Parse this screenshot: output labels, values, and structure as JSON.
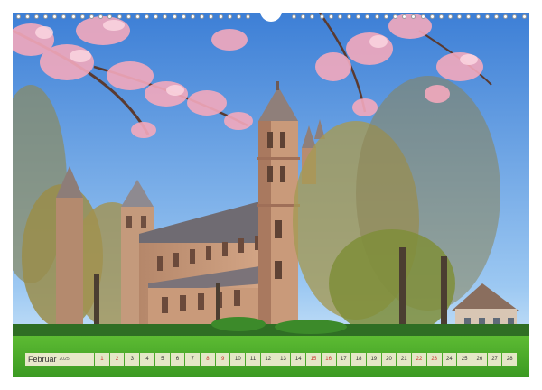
{
  "calendar": {
    "month": "Februar",
    "year": "2025",
    "days": [
      "1",
      "2",
      "3",
      "4",
      "5",
      "6",
      "7",
      "8",
      "9",
      "10",
      "11",
      "12",
      "13",
      "14",
      "15",
      "16",
      "17",
      "18",
      "19",
      "20",
      "21",
      "22",
      "23",
      "24",
      "25",
      "26",
      "27",
      "28"
    ],
    "weekend_days": [
      1,
      2,
      8,
      9,
      15,
      16,
      22,
      23
    ],
    "binding_hole_count": 56
  },
  "photo": {
    "subject": "cathedral-with-cherry-blossoms",
    "colors": {
      "sky_top": "#3d7fd6",
      "sky_bottom": "#cfe6fb",
      "stone": "#c99a7a",
      "stone_shade": "#9f6f58",
      "roof": "#6d6a6f",
      "grass": "#4aa82a",
      "blossom": "#f3a9bd"
    }
  }
}
